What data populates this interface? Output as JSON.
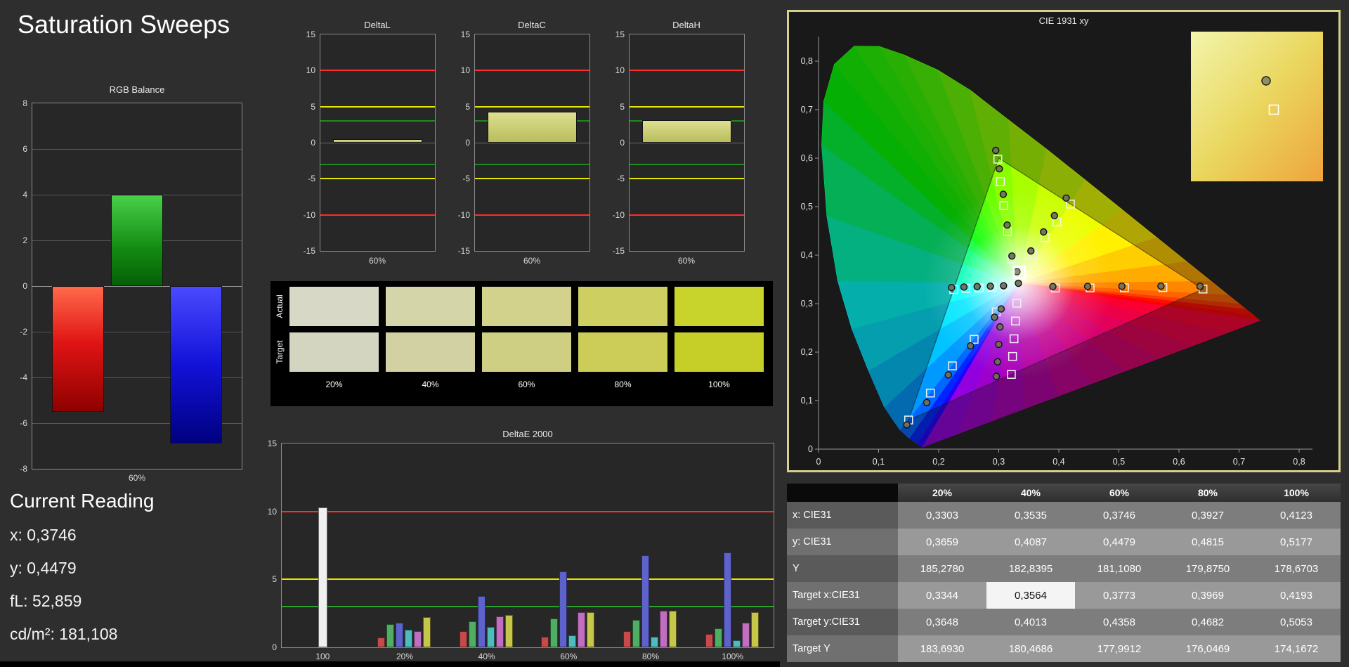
{
  "title": "Saturation Sweeps",
  "current_reading": {
    "heading": "Current Reading",
    "x": "x: 0,3746",
    "y": "y: 0,4479",
    "fL": "fL: 52,859",
    "cdm2": "cd/m²: 181,108"
  },
  "swatch_panel": {
    "row_labels": [
      "Actual",
      "Target"
    ],
    "column_labels": [
      "20%",
      "40%",
      "60%",
      "80%",
      "100%"
    ],
    "actual_colors": [
      "#d7d9c6",
      "#d5d5aa",
      "#d2d28c",
      "#cdd061",
      "#c8d32b"
    ],
    "target_colors": [
      "#d3d5c0",
      "#d1d1a3",
      "#cecf83",
      "#cbcd58",
      "#c6cf27"
    ]
  },
  "table": {
    "headers": [
      "",
      "20%",
      "40%",
      "60%",
      "80%",
      "100%"
    ],
    "rows": [
      {
        "label": "x: CIE31",
        "values": [
          "0,3303",
          "0,3535",
          "0,3746",
          "0,3927",
          "0,4123"
        ]
      },
      {
        "label": "y: CIE31",
        "values": [
          "0,3659",
          "0,4087",
          "0,4479",
          "0,4815",
          "0,5177"
        ]
      },
      {
        "label": "Y",
        "values": [
          "185,2780",
          "182,8395",
          "181,1080",
          "179,8750",
          "178,6703"
        ]
      },
      {
        "label": "Target x:CIE31",
        "values": [
          "0,3344",
          "0,3564",
          "0,3773",
          "0,3969",
          "0,4193"
        ]
      },
      {
        "label": "Target y:CIE31",
        "values": [
          "0,3648",
          "0,4013",
          "0,4358",
          "0,4682",
          "0,5053"
        ]
      },
      {
        "label": "Target Y",
        "values": [
          "183,6930",
          "180,4686",
          "177,9912",
          "176,0469",
          "174,1672"
        ]
      }
    ],
    "highlight": {
      "row": 3,
      "col": 1
    }
  },
  "chart_data": [
    {
      "id": "rgb_balance",
      "type": "bar",
      "title": "RGB Balance",
      "categories": [
        "Red",
        "Green",
        "Blue"
      ],
      "values": [
        -5.5,
        4,
        -6.9
      ],
      "xlabel": "60%",
      "ylim": [
        -8,
        8
      ],
      "yticks": [
        "8",
        "6",
        "4",
        "2",
        "0",
        "-2",
        "-4",
        "-6",
        "-8"
      ]
    },
    {
      "id": "delta_l",
      "type": "bar",
      "title": "DeltaL",
      "categories": [
        "60%"
      ],
      "values": [
        0.5
      ],
      "xlabel": "60%",
      "ylim": [
        -15,
        15
      ],
      "yticks": [
        "15",
        "10",
        "5",
        "0",
        "-5",
        "-10",
        "-15"
      ],
      "ref_lines": [
        {
          "value": 10,
          "color": "#ff2d2d"
        },
        {
          "value": 5,
          "color": "#e6e600"
        },
        {
          "value": 3,
          "color": "#1f8a1f"
        },
        {
          "value": -3,
          "color": "#1f8a1f"
        },
        {
          "value": -5,
          "color": "#e6e600"
        },
        {
          "value": -10,
          "color": "#ff2d2d"
        }
      ]
    },
    {
      "id": "delta_c",
      "type": "bar",
      "title": "DeltaC",
      "categories": [
        "60%"
      ],
      "values": [
        4.3
      ],
      "xlabel": "60%",
      "ylim": [
        -15,
        15
      ],
      "yticks": [
        "15",
        "10",
        "5",
        "0",
        "-5",
        "-10",
        "-15"
      ],
      "ref_lines": [
        {
          "value": 10,
          "color": "#ff2d2d"
        },
        {
          "value": 5,
          "color": "#e6e600"
        },
        {
          "value": 3,
          "color": "#1f8a1f"
        },
        {
          "value": -3,
          "color": "#1f8a1f"
        },
        {
          "value": -5,
          "color": "#e6e600"
        },
        {
          "value": -10,
          "color": "#ff2d2d"
        }
      ]
    },
    {
      "id": "delta_h",
      "type": "bar",
      "title": "DeltaH",
      "categories": [
        "60%"
      ],
      "values": [
        3.1
      ],
      "xlabel": "60%",
      "ylim": [
        -15,
        15
      ],
      "yticks": [
        "15",
        "10",
        "5",
        "0",
        "-5",
        "-10",
        "-15"
      ],
      "ref_lines": [
        {
          "value": 10,
          "color": "#ff2d2d"
        },
        {
          "value": 5,
          "color": "#e6e600"
        },
        {
          "value": 3,
          "color": "#1f8a1f"
        },
        {
          "value": -3,
          "color": "#1f8a1f"
        },
        {
          "value": -5,
          "color": "#e6e600"
        },
        {
          "value": -10,
          "color": "#ff2d2d"
        }
      ]
    },
    {
      "id": "delta_e_2000",
      "type": "bar",
      "title": "DeltaE 2000",
      "categories": [
        "100",
        "20%",
        "40%",
        "60%",
        "80%",
        "100%"
      ],
      "ylim": [
        0,
        15
      ],
      "yticks": [
        "15",
        "10",
        "5",
        "0"
      ],
      "ref_lines": [
        {
          "value": 10,
          "color": "#ff2d2d"
        },
        {
          "value": 5,
          "color": "#e6e600"
        },
        {
          "value": 3,
          "color": "#2da32d"
        }
      ],
      "series": [
        {
          "name": "White",
          "color": "#f0f0f0",
          "values": [
            10.3,
            null,
            null,
            null,
            null,
            null
          ]
        },
        {
          "name": "Red",
          "color": "#c64a4a",
          "values": [
            null,
            0.7,
            1.2,
            0.8,
            1.2,
            1.0
          ]
        },
        {
          "name": "Green",
          "color": "#4fae62",
          "values": [
            null,
            1.7,
            1.9,
            2.1,
            2.0,
            1.4
          ]
        },
        {
          "name": "Blue",
          "color": "#5e63cc",
          "values": [
            null,
            1.8,
            3.8,
            5.6,
            6.8,
            7.0
          ]
        },
        {
          "name": "Cyan",
          "color": "#4cbcbc",
          "values": [
            null,
            1.3,
            1.5,
            0.9,
            0.8,
            0.5
          ]
        },
        {
          "name": "Magenta",
          "color": "#c16ec1",
          "values": [
            null,
            1.2,
            2.3,
            2.6,
            2.7,
            1.8
          ]
        },
        {
          "name": "Yellow",
          "color": "#c6c64a",
          "values": [
            null,
            2.2,
            2.4,
            2.6,
            2.7,
            2.6
          ]
        }
      ]
    },
    {
      "id": "cie_1931_xy",
      "type": "scatter",
      "title": "CIE 1931 xy",
      "xlim": [
        0,
        0.85
      ],
      "ylim": [
        0,
        0.85
      ],
      "xticks": [
        "0",
        "0,1",
        "0,2",
        "0,3",
        "0,4",
        "0,5",
        "0,6",
        "0,7",
        "0,8"
      ],
      "yticks": [
        "0",
        "0,1",
        "0,2",
        "0,3",
        "0,4",
        "0,5",
        "0,6",
        "0,7",
        "0,8"
      ],
      "white_point": [
        0.3327,
        0.3415
      ],
      "highlight_target": [
        0.3344,
        0.3648
      ],
      "current": {
        "measured": [
          0.3746,
          0.4479
        ],
        "target": [
          0.3773,
          0.4358
        ]
      },
      "targets": [
        [
          0.3344,
          0.3648
        ],
        [
          0.3564,
          0.4013
        ],
        [
          0.3773,
          0.4358
        ],
        [
          0.3969,
          0.4682
        ],
        [
          0.4193,
          0.5053
        ],
        [
          0.3216,
          0.3921
        ],
        [
          0.3144,
          0.4489
        ],
        [
          0.3082,
          0.5022
        ],
        [
          0.3029,
          0.5517
        ],
        [
          0.2985,
          0.5978
        ],
        [
          0.3942,
          0.3321
        ],
        [
          0.4521,
          0.3324
        ],
        [
          0.5092,
          0.3327
        ],
        [
          0.5732,
          0.333
        ],
        [
          0.64,
          0.33
        ],
        [
          0.2958,
          0.2829
        ],
        [
          0.259,
          0.2264
        ],
        [
          0.2228,
          0.1717
        ],
        [
          0.1862,
          0.1156
        ],
        [
          0.15,
          0.06
        ],
        [
          0.3108,
          0.335
        ],
        [
          0.289,
          0.3337
        ],
        [
          0.2672,
          0.3324
        ],
        [
          0.2452,
          0.3311
        ],
        [
          0.225,
          0.329
        ],
        [
          0.3302,
          0.3009
        ],
        [
          0.3278,
          0.2641
        ],
        [
          0.3254,
          0.2276
        ],
        [
          0.323,
          0.1911
        ],
        [
          0.321,
          0.154
        ]
      ],
      "measured": [
        [
          0.3303,
          0.3659
        ],
        [
          0.3535,
          0.4087
        ],
        [
          0.3746,
          0.4479
        ],
        [
          0.3927,
          0.4815
        ],
        [
          0.4123,
          0.5177
        ],
        [
          0.3219,
          0.3981
        ],
        [
          0.314,
          0.462
        ],
        [
          0.3075,
          0.5255
        ],
        [
          0.301,
          0.578
        ],
        [
          0.295,
          0.616
        ],
        [
          0.3901,
          0.3352
        ],
        [
          0.448,
          0.3356
        ],
        [
          0.505,
          0.336
        ],
        [
          0.57,
          0.3362
        ],
        [
          0.635,
          0.3358
        ],
        [
          0.293,
          0.272
        ],
        [
          0.253,
          0.213
        ],
        [
          0.216,
          0.153
        ],
        [
          0.18,
          0.096
        ],
        [
          0.147,
          0.05
        ],
        [
          0.308,
          0.3368
        ],
        [
          0.286,
          0.336
        ],
        [
          0.264,
          0.3352
        ],
        [
          0.242,
          0.3344
        ],
        [
          0.2215,
          0.333
        ],
        [
          0.304,
          0.289
        ],
        [
          0.302,
          0.252
        ],
        [
          0.3,
          0.216
        ],
        [
          0.298,
          0.18
        ],
        [
          0.296,
          0.15
        ],
        [
          0.3327,
          0.342
        ]
      ]
    }
  ]
}
